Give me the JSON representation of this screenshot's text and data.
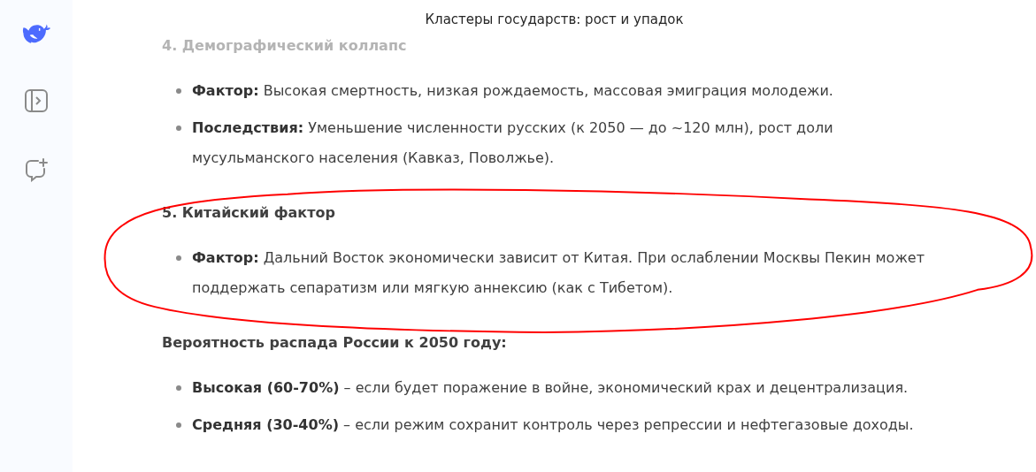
{
  "header": {
    "title": "Кластеры государств: рост и упадок"
  },
  "sections": [
    {
      "heading": "4. Демографический коллапс",
      "faded": true,
      "items": [
        "**Фактор:** Высокая смертность, низкая рождаемость, массовая эмиграция молодежи.",
        "**Последствия:** Уменьшение численности русских (к 2050 — до ~120 млн), рост доли мусульманского населения (Кавказ, Поволжье)."
      ]
    },
    {
      "heading": "5. Китайский фактор",
      "faded": false,
      "items": [
        "**Фактор:** Дальний Восток экономически зависит от Китая. При ослаблении Москвы Пекин может поддержать сепаратизм или мягкую аннексию (как с Тибетом)."
      ]
    },
    {
      "heading": "Вероятность распада России к 2050 году:",
      "faded": false,
      "items": [
        "**Высокая (60-70%)** – если будет поражение в войне, экономический крах и децентрализация.",
        "**Средняя (30-40%)** – если режим сохранит контроль через репрессии и нефтегазовые доходы."
      ]
    }
  ]
}
